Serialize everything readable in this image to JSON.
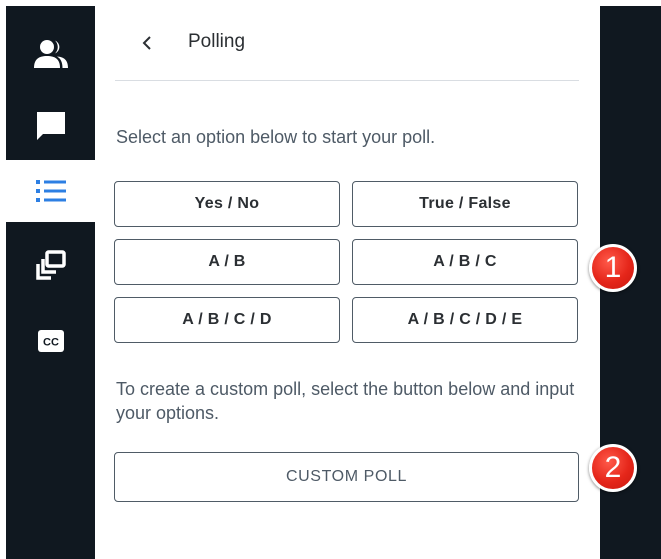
{
  "header": {
    "title": "Polling",
    "back_icon": "chevron-left-icon"
  },
  "sidebar": {
    "items": [
      {
        "icon": "users-icon",
        "active": false
      },
      {
        "icon": "chat-icon",
        "active": false
      },
      {
        "icon": "list-icon",
        "active": true
      },
      {
        "icon": "screen-share-icon",
        "active": false
      },
      {
        "icon": "closed-captions-icon",
        "active": false
      }
    ]
  },
  "poll": {
    "instruction": "Select an option below to start your poll.",
    "options": [
      "Yes / No",
      "True / False",
      "A / B",
      "A / B / C",
      "A / B / C / D",
      "A / B / C / D / E"
    ],
    "custom_text": "To create a custom poll, select the button below and input your options.",
    "custom_button": "CUSTOM POLL"
  },
  "callouts": [
    "1",
    "2"
  ],
  "colors": {
    "rail_background": "#101820",
    "active_icon": "#2d7fe3",
    "border": "#4f5b66",
    "callout": "#e5261a"
  }
}
